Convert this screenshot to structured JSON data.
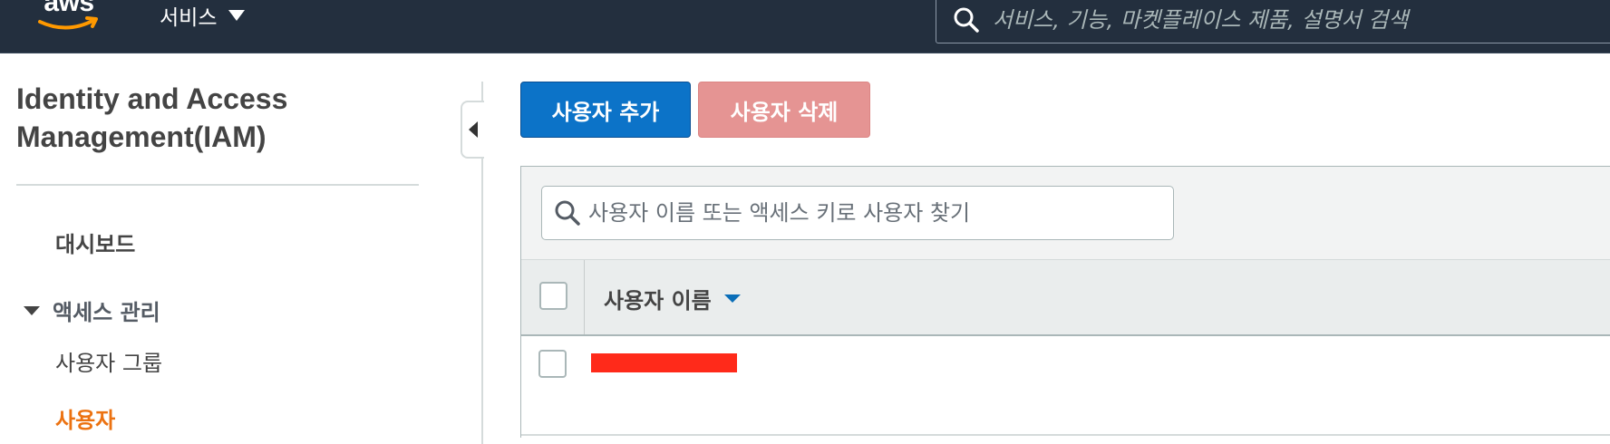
{
  "topnav": {
    "logo_text": "aws",
    "services_label": "서비스",
    "search_placeholder": "서비스, 기능, 마켓플레이스 제품, 설명서 검색"
  },
  "sidebar": {
    "title": "Identity and Access Management(IAM)",
    "dashboard": "대시보드",
    "section": "액세스 관리",
    "items": [
      {
        "label": "사용자 그룹",
        "active": false
      },
      {
        "label": "사용자",
        "active": true
      }
    ]
  },
  "toolbar": {
    "add_user_label": "사용자 추가",
    "delete_user_label": "사용자 삭제"
  },
  "table": {
    "search_placeholder": "사용자 이름 또는 액세스 키로 사용자 찾기",
    "columns": [
      "사용자 이름"
    ],
    "rows": [
      {
        "username_redacted": true
      }
    ]
  },
  "colors": {
    "nav_bg": "#232f3e",
    "primary_button": "#0c73c8",
    "danger_button_disabled": "#e59493",
    "active_nav": "#ec7211",
    "redaction": "#ff2a1a"
  },
  "icons": [
    "search-icon",
    "caret-down-icon",
    "collapse-left-icon",
    "sort-desc-icon"
  ]
}
